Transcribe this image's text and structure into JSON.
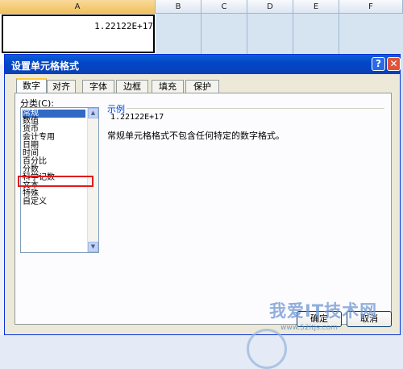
{
  "spreadsheet": {
    "columns": [
      "A",
      "B",
      "C",
      "D",
      "E",
      "F"
    ],
    "cell_value": "1.22122E+17"
  },
  "dialog": {
    "title": "设置单元格格式",
    "help_glyph": "?",
    "close_glyph": "✕",
    "tabs": [
      "数字",
      "对齐",
      "字体",
      "边框",
      "填充",
      "保护"
    ],
    "active_tab": "数字",
    "category_label": "分类(C):",
    "categories": [
      "常规",
      "数值",
      "货币",
      "会计专用",
      "日期",
      "时间",
      "百分比",
      "分数",
      "科学记数",
      "文本",
      "特殊",
      "自定义"
    ],
    "selected_category": "常规",
    "highlighted_category": "文本",
    "sample_title": "示例",
    "sample_value": "1.22122E+17",
    "description": "常规单元格格式不包含任何特定的数字格式。",
    "ok_label": "确定",
    "cancel_label": "取消"
  },
  "watermark": {
    "text": "我爱IT技术网",
    "url": "www.52itjs.com"
  },
  "colors": {
    "title_bar": "#0a5fd8",
    "selection": "#316ac5",
    "highlight_box": "#e01b1b"
  }
}
